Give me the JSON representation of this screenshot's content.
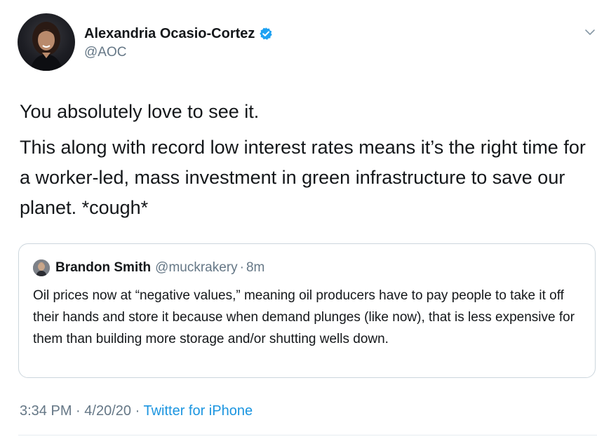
{
  "author": {
    "name": "Alexandria Ocasio-Cortez",
    "handle": "@AOC",
    "verified_color": "#1da1f2"
  },
  "tweet": {
    "paragraphs": [
      "You absolutely love to see it.",
      "This along with record low interest rates means it’s the right time for a worker-led, mass investment in green infrastructure to save our planet. *cough*"
    ]
  },
  "quote": {
    "author_name": "Brandon Smith",
    "author_handle": "@muckrakery",
    "separator": "·",
    "time": "8m",
    "text": "Oil prices now at “negative values,” meaning oil producers have to pay people to take it off their hands and store it because when demand plunges (like now), that is less expensive for them than building more storage and/or shutting wells down."
  },
  "meta": {
    "time": "3:34 PM",
    "separator": "·",
    "date": "4/20/20",
    "source": "Twitter for iPhone"
  },
  "icons": {
    "verified": "verified-badge-icon",
    "menu": "chevron-down-icon"
  },
  "colors": {
    "text": "#14171a",
    "secondary": "#657786",
    "link": "#1b95e0",
    "border": "#ccd6dd"
  }
}
